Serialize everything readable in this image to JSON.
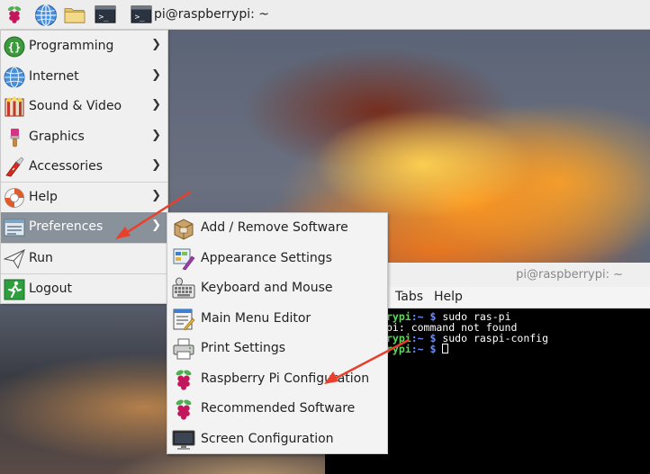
{
  "taskbar": {
    "window_label": "pi@raspberrypi: ~",
    "icons": [
      "raspberry-icon",
      "web-browser-icon",
      "file-manager-icon",
      "terminal-icon",
      "terminal-icon"
    ]
  },
  "main_menu": {
    "items": [
      {
        "label": "Programming",
        "icon": "programming-icon",
        "has_submenu": true
      },
      {
        "label": "Internet",
        "icon": "internet-globe-icon",
        "has_submenu": true
      },
      {
        "label": "Sound & Video",
        "icon": "sound-video-icon",
        "has_submenu": true
      },
      {
        "label": "Graphics",
        "icon": "graphics-brush-icon",
        "has_submenu": true
      },
      {
        "label": "Accessories",
        "icon": "accessories-knife-icon",
        "has_submenu": true
      },
      {
        "label": "Help",
        "icon": "help-lifebuoy-icon",
        "has_submenu": true
      },
      {
        "label": "Preferences",
        "icon": "preferences-icon",
        "has_submenu": true,
        "selected": true
      },
      {
        "label": "Run",
        "icon": "run-paperplane-icon",
        "has_submenu": false
      },
      {
        "label": "Logout",
        "icon": "logout-icon",
        "has_submenu": false
      }
    ],
    "arrow_glyph": "❯"
  },
  "preferences_submenu": {
    "items": [
      {
        "label": "Add / Remove Software",
        "icon": "package-icon"
      },
      {
        "label": "Appearance Settings",
        "icon": "appearance-icon"
      },
      {
        "label": "Keyboard and Mouse",
        "icon": "keyboard-mouse-icon"
      },
      {
        "label": "Main Menu Editor",
        "icon": "menu-editor-icon"
      },
      {
        "label": "Print Settings",
        "icon": "printer-icon"
      },
      {
        "label": "Raspberry Pi Configuration",
        "icon": "raspberry-icon"
      },
      {
        "label": "Recommended Software",
        "icon": "raspberry-icon"
      },
      {
        "label": "Screen Configuration",
        "icon": "monitor-icon"
      }
    ]
  },
  "terminal": {
    "title": "pi@raspberrypi: ~",
    "menu": {
      "tabs": "Tabs",
      "help": "Help"
    },
    "lines": [
      {
        "prompt_user": "rypi",
        "prompt_path": ":~ $",
        "command": " sudo ras-pi"
      },
      {
        "output": "pi: command not found"
      },
      {
        "prompt_user": "rypi",
        "prompt_path": ":~ $",
        "command": " sudo raspi-config"
      },
      {
        "prompt_user": "rypi",
        "prompt_path": ":~ $",
        "command": " ",
        "cursor": true
      }
    ]
  },
  "colors": {
    "menu_bg": "#f0f0f0",
    "menu_selected": "#89919b",
    "annotation_arrow": "#e8402a",
    "prompt_user": "#5fd75f",
    "prompt_path": "#6b8cff"
  }
}
